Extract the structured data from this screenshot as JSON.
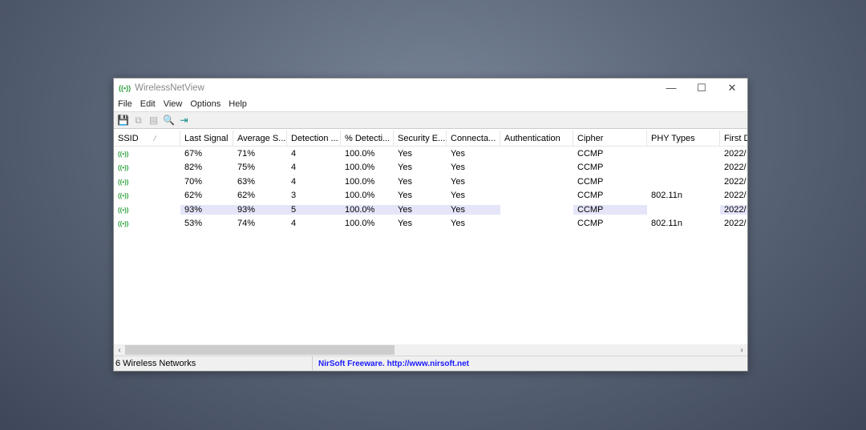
{
  "window": {
    "title": "WirelessNetView",
    "minimize": "—",
    "maximize": "☐",
    "close": "✕"
  },
  "menu": [
    "File",
    "Edit",
    "View",
    "Options",
    "Help"
  ],
  "columns": [
    "SSID",
    "Last Signal",
    "Average S...",
    "Detection ...",
    "% Detecti...",
    "Security E...",
    "Connecta...",
    "Authentication",
    "Cipher",
    "PHY Types",
    "First D"
  ],
  "sort_indicator": "⁄",
  "rows": [
    [
      "",
      "67%",
      "71%",
      "4",
      "100.0%",
      "Yes",
      "Yes",
      "",
      "CCMP",
      "",
      "2022/"
    ],
    [
      "",
      "82%",
      "75%",
      "4",
      "100.0%",
      "Yes",
      "Yes",
      "",
      "CCMP",
      "",
      "2022/"
    ],
    [
      "",
      "70%",
      "63%",
      "4",
      "100.0%",
      "Yes",
      "Yes",
      "",
      "CCMP",
      "",
      "2022/"
    ],
    [
      "",
      "62%",
      "62%",
      "3",
      "100.0%",
      "Yes",
      "Yes",
      "",
      "CCMP",
      "802.11n",
      "2022/"
    ],
    [
      "",
      "93%",
      "93%",
      "5",
      "100.0%",
      "Yes",
      "Yes",
      "",
      "CCMP",
      "",
      "2022/"
    ],
    [
      "",
      "53%",
      "74%",
      "4",
      "100.0%",
      "Yes",
      "Yes",
      "",
      "CCMP",
      "802.11n",
      "2022/"
    ]
  ],
  "selected_row": 4,
  "status": {
    "count": "6 Wireless Networks",
    "credit": "NirSoft Freeware.  http://www.nirsoft.net"
  }
}
